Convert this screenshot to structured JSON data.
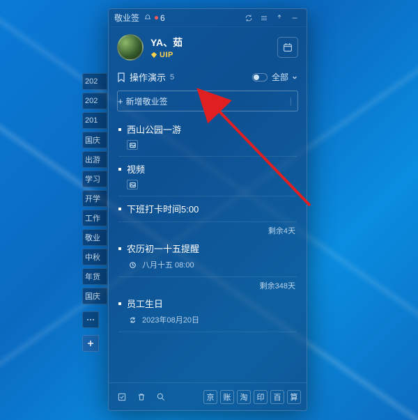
{
  "titlebar": {
    "app_name": "敬业签",
    "notification_count": "6"
  },
  "profile": {
    "username": "YA、茹",
    "vip_label": "UIP"
  },
  "section": {
    "title": "操作演示",
    "count": "5",
    "filter_label": "全部"
  },
  "add_button": {
    "label": "新增敬业签"
  },
  "items": [
    {
      "title": "西山公园一游",
      "meta_icon": "image",
      "meta_text": "",
      "remaining": ""
    },
    {
      "title": "视频",
      "meta_icon": "image",
      "meta_text": "",
      "remaining": ""
    },
    {
      "title": "下班打卡时间5:00",
      "meta_icon": "",
      "meta_text": "",
      "remaining": "剩余4天"
    },
    {
      "title": "农历初一十五提醒",
      "meta_icon": "clock",
      "meta_text": "八月十五 08:00",
      "remaining": "剩余348天"
    },
    {
      "title": "员工生日",
      "meta_icon": "repeat",
      "meta_text": "2023年08月20日",
      "remaining": ""
    }
  ],
  "left_tabs": [
    "202",
    "202",
    "201",
    "国庆",
    "出游",
    "学习",
    "开学",
    "工作",
    "敬业",
    "中秋",
    "年货",
    "国庆"
  ],
  "bottom_brands": [
    "京",
    "账",
    "淘",
    "印",
    "百",
    "算"
  ]
}
